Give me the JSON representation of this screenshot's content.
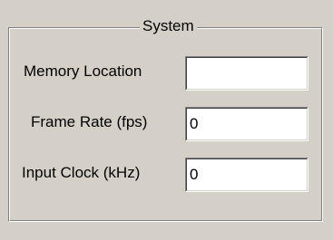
{
  "group": {
    "title": "System"
  },
  "fields": [
    {
      "label": "Memory Location",
      "value": ""
    },
    {
      "label": "Frame Rate (fps)",
      "value": "0"
    },
    {
      "label": "Input Clock (kHz)",
      "value": "0"
    }
  ]
}
